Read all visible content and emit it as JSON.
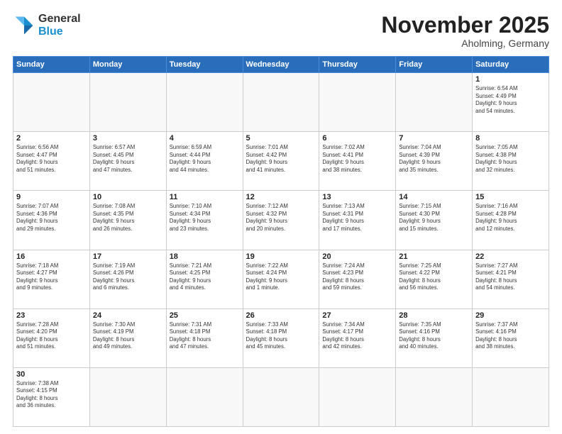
{
  "logo": {
    "line1": "General",
    "line2": "Blue"
  },
  "header": {
    "month_year": "November 2025",
    "location": "Aholming, Germany"
  },
  "weekdays": [
    "Sunday",
    "Monday",
    "Tuesday",
    "Wednesday",
    "Thursday",
    "Friday",
    "Saturday"
  ],
  "weeks": [
    [
      {
        "day": "",
        "info": ""
      },
      {
        "day": "",
        "info": ""
      },
      {
        "day": "",
        "info": ""
      },
      {
        "day": "",
        "info": ""
      },
      {
        "day": "",
        "info": ""
      },
      {
        "day": "",
        "info": ""
      },
      {
        "day": "1",
        "info": "Sunrise: 6:54 AM\nSunset: 4:49 PM\nDaylight: 9 hours\nand 54 minutes."
      }
    ],
    [
      {
        "day": "2",
        "info": "Sunrise: 6:56 AM\nSunset: 4:47 PM\nDaylight: 9 hours\nand 51 minutes."
      },
      {
        "day": "3",
        "info": "Sunrise: 6:57 AM\nSunset: 4:45 PM\nDaylight: 9 hours\nand 47 minutes."
      },
      {
        "day": "4",
        "info": "Sunrise: 6:59 AM\nSunset: 4:44 PM\nDaylight: 9 hours\nand 44 minutes."
      },
      {
        "day": "5",
        "info": "Sunrise: 7:01 AM\nSunset: 4:42 PM\nDaylight: 9 hours\nand 41 minutes."
      },
      {
        "day": "6",
        "info": "Sunrise: 7:02 AM\nSunset: 4:41 PM\nDaylight: 9 hours\nand 38 minutes."
      },
      {
        "day": "7",
        "info": "Sunrise: 7:04 AM\nSunset: 4:39 PM\nDaylight: 9 hours\nand 35 minutes."
      },
      {
        "day": "8",
        "info": "Sunrise: 7:05 AM\nSunset: 4:38 PM\nDaylight: 9 hours\nand 32 minutes."
      }
    ],
    [
      {
        "day": "9",
        "info": "Sunrise: 7:07 AM\nSunset: 4:36 PM\nDaylight: 9 hours\nand 29 minutes."
      },
      {
        "day": "10",
        "info": "Sunrise: 7:08 AM\nSunset: 4:35 PM\nDaylight: 9 hours\nand 26 minutes."
      },
      {
        "day": "11",
        "info": "Sunrise: 7:10 AM\nSunset: 4:34 PM\nDaylight: 9 hours\nand 23 minutes."
      },
      {
        "day": "12",
        "info": "Sunrise: 7:12 AM\nSunset: 4:32 PM\nDaylight: 9 hours\nand 20 minutes."
      },
      {
        "day": "13",
        "info": "Sunrise: 7:13 AM\nSunset: 4:31 PM\nDaylight: 9 hours\nand 17 minutes."
      },
      {
        "day": "14",
        "info": "Sunrise: 7:15 AM\nSunset: 4:30 PM\nDaylight: 9 hours\nand 15 minutes."
      },
      {
        "day": "15",
        "info": "Sunrise: 7:16 AM\nSunset: 4:28 PM\nDaylight: 9 hours\nand 12 minutes."
      }
    ],
    [
      {
        "day": "16",
        "info": "Sunrise: 7:18 AM\nSunset: 4:27 PM\nDaylight: 9 hours\nand 9 minutes."
      },
      {
        "day": "17",
        "info": "Sunrise: 7:19 AM\nSunset: 4:26 PM\nDaylight: 9 hours\nand 6 minutes."
      },
      {
        "day": "18",
        "info": "Sunrise: 7:21 AM\nSunset: 4:25 PM\nDaylight: 9 hours\nand 4 minutes."
      },
      {
        "day": "19",
        "info": "Sunrise: 7:22 AM\nSunset: 4:24 PM\nDaylight: 9 hours\nand 1 minute."
      },
      {
        "day": "20",
        "info": "Sunrise: 7:24 AM\nSunset: 4:23 PM\nDaylight: 8 hours\nand 59 minutes."
      },
      {
        "day": "21",
        "info": "Sunrise: 7:25 AM\nSunset: 4:22 PM\nDaylight: 8 hours\nand 56 minutes."
      },
      {
        "day": "22",
        "info": "Sunrise: 7:27 AM\nSunset: 4:21 PM\nDaylight: 8 hours\nand 54 minutes."
      }
    ],
    [
      {
        "day": "23",
        "info": "Sunrise: 7:28 AM\nSunset: 4:20 PM\nDaylight: 8 hours\nand 51 minutes."
      },
      {
        "day": "24",
        "info": "Sunrise: 7:30 AM\nSunset: 4:19 PM\nDaylight: 8 hours\nand 49 minutes."
      },
      {
        "day": "25",
        "info": "Sunrise: 7:31 AM\nSunset: 4:18 PM\nDaylight: 8 hours\nand 47 minutes."
      },
      {
        "day": "26",
        "info": "Sunrise: 7:33 AM\nSunset: 4:18 PM\nDaylight: 8 hours\nand 45 minutes."
      },
      {
        "day": "27",
        "info": "Sunrise: 7:34 AM\nSunset: 4:17 PM\nDaylight: 8 hours\nand 42 minutes."
      },
      {
        "day": "28",
        "info": "Sunrise: 7:35 AM\nSunset: 4:16 PM\nDaylight: 8 hours\nand 40 minutes."
      },
      {
        "day": "29",
        "info": "Sunrise: 7:37 AM\nSunset: 4:16 PM\nDaylight: 8 hours\nand 38 minutes."
      }
    ],
    [
      {
        "day": "30",
        "info": "Sunrise: 7:38 AM\nSunset: 4:15 PM\nDaylight: 8 hours\nand 36 minutes."
      },
      {
        "day": "",
        "info": ""
      },
      {
        "day": "",
        "info": ""
      },
      {
        "day": "",
        "info": ""
      },
      {
        "day": "",
        "info": ""
      },
      {
        "day": "",
        "info": ""
      },
      {
        "day": "",
        "info": ""
      }
    ]
  ]
}
